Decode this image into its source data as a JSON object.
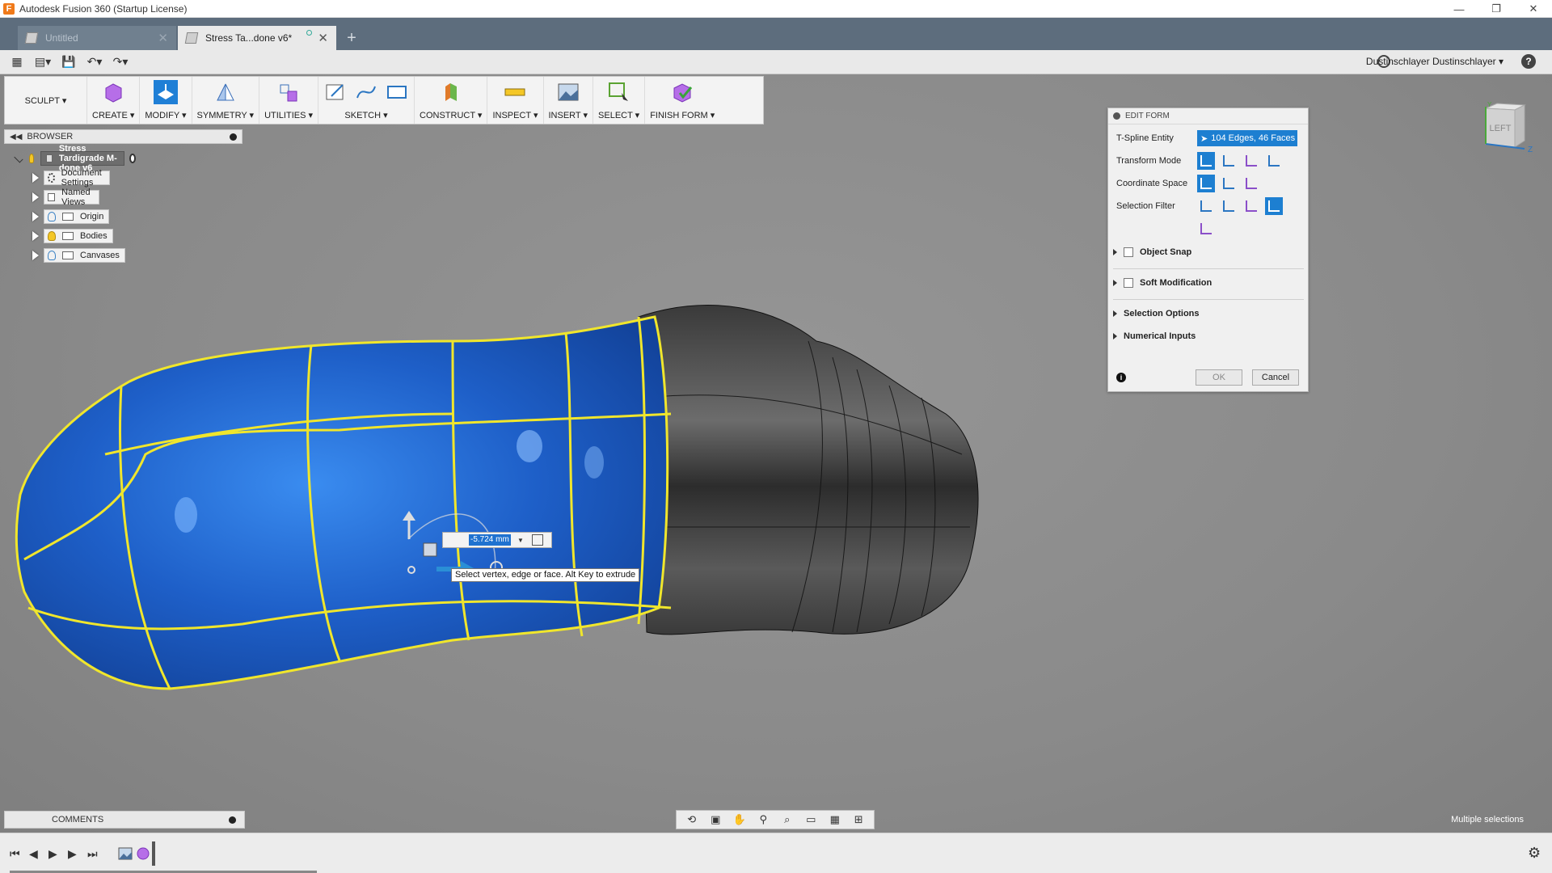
{
  "window": {
    "title": "Autodesk Fusion 360 (Startup License)",
    "controls": [
      "—",
      "❐",
      "✕"
    ]
  },
  "tabs": [
    {
      "label": "Untitled",
      "active": false
    },
    {
      "label": "Stress Ta...done v6*",
      "active": true
    }
  ],
  "appbar": {
    "user": "Dustinschlayer Dustinschlayer ▾"
  },
  "toolbar": {
    "workspace": "SCULPT ▾",
    "groups": [
      {
        "label": "CREATE ▾"
      },
      {
        "label": "MODIFY ▾"
      },
      {
        "label": "SYMMETRY ▾"
      },
      {
        "label": "UTILITIES ▾"
      },
      {
        "label": "SKETCH ▾"
      },
      {
        "label": "CONSTRUCT ▾"
      },
      {
        "label": "INSPECT ▾"
      },
      {
        "label": "INSERT ▾"
      },
      {
        "label": "SELECT ▾"
      },
      {
        "label": "FINISH FORM ▾"
      }
    ]
  },
  "browser": {
    "title": "BROWSER",
    "root": "Stress Tardigrade M-done v6",
    "items": [
      {
        "label": "Document Settings",
        "icon": "gear-icon"
      },
      {
        "label": "Named Views",
        "icon": "folder-icon"
      },
      {
        "label": "Origin",
        "icon": "folder-icon",
        "visible": false
      },
      {
        "label": "Bodies",
        "icon": "folder-icon",
        "visible": true
      },
      {
        "label": "Canvases",
        "icon": "folder-icon",
        "visible": false
      }
    ]
  },
  "editform": {
    "title": "EDIT FORM",
    "rows": {
      "entity_label": "T-Spline Entity",
      "entity_value": "104 Edges, 46 Faces",
      "transform_label": "Transform Mode",
      "coord_label": "Coordinate Space",
      "filter_label": "Selection Filter"
    },
    "sections": {
      "object_snap": "Object Snap",
      "soft_mod": "Soft Modification",
      "sel_options": "Selection Options",
      "num_inputs": "Numerical Inputs"
    },
    "ok": "OK",
    "cancel": "Cancel"
  },
  "viewcube": {
    "face": "LEFT"
  },
  "manipulator": {
    "distance": "-5.724 mm",
    "tooltip": "Select vertex, edge or face. Alt Key to extrude"
  },
  "comments": {
    "title": "COMMENTS"
  },
  "status": {
    "text": "Multiple selections"
  },
  "colors": {
    "accent": "#1f7fd6",
    "selection_blue": "#1e5fc8",
    "edge_yellow": "#f0e62c"
  }
}
